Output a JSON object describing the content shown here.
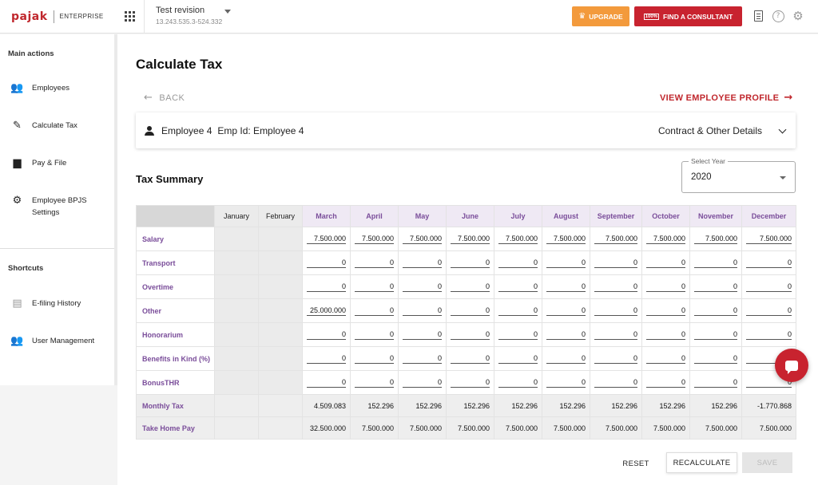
{
  "header": {
    "logo_text": "pajak",
    "edition": "ENTERPRISE",
    "revision_title": "Test revision",
    "revision_id": "13.243.535.3-524.332",
    "upgrade_label": "UPGRADE",
    "consultant_label": "FIND A CONSULTANT",
    "consultant_badge": "100%"
  },
  "sidebar": {
    "main_actions_title": "Main actions",
    "items": [
      {
        "label": "Employees",
        "icon": "people-icon"
      },
      {
        "label": "Calculate Tax",
        "icon": "pencil-icon"
      },
      {
        "label": "Pay & File",
        "icon": "document-icon"
      },
      {
        "label": "Employee BPJS Settings",
        "icon": "gear-icon"
      }
    ],
    "shortcuts_title": "Shortcuts",
    "shortcuts": [
      {
        "label": "E-filing History",
        "icon": "efiling-icon"
      },
      {
        "label": "User Management",
        "icon": "users-icon"
      }
    ]
  },
  "page": {
    "title": "Calculate Tax",
    "back_label": "BACK",
    "view_profile_label": "VIEW EMPLOYEE PROFILE"
  },
  "employee": {
    "name": "Employee 4",
    "emp_id_text": "Emp Id: Employee 4",
    "contract_label": "Contract & Other Details"
  },
  "summary": {
    "title": "Tax Summary",
    "year_label": "Select Year",
    "year_value": "2020"
  },
  "table": {
    "months": [
      "January",
      "February",
      "March",
      "April",
      "May",
      "June",
      "July",
      "August",
      "September",
      "October",
      "November",
      "December"
    ],
    "input_rows": [
      {
        "label": "Salary",
        "values": [
          "7.500.000",
          "7.500.000",
          "7.500.000",
          "7.500.000",
          "7.500.000",
          "7.500.000",
          "7.500.000",
          "7.500.000",
          "7.500.000",
          "7.500.000"
        ]
      },
      {
        "label": "Transport",
        "values": [
          "0",
          "0",
          "0",
          "0",
          "0",
          "0",
          "0",
          "0",
          "0",
          "0"
        ]
      },
      {
        "label": "Overtime",
        "values": [
          "0",
          "0",
          "0",
          "0",
          "0",
          "0",
          "0",
          "0",
          "0",
          "0"
        ]
      },
      {
        "label": "Other",
        "values": [
          "25.000.000",
          "0",
          "0",
          "0",
          "0",
          "0",
          "0",
          "0",
          "0",
          "0"
        ]
      },
      {
        "label": "Honorarium",
        "values": [
          "0",
          "0",
          "0",
          "0",
          "0",
          "0",
          "0",
          "0",
          "0",
          "0"
        ]
      },
      {
        "label": "Benefits in Kind (%)",
        "values": [
          "0",
          "0",
          "0",
          "0",
          "0",
          "0",
          "0",
          "0",
          "0",
          "0"
        ]
      },
      {
        "label": "BonusTHR",
        "values": [
          "0",
          "0",
          "0",
          "0",
          "0",
          "0",
          "0",
          "0",
          "0",
          "0"
        ]
      }
    ],
    "calc_rows": [
      {
        "label": "Monthly Tax",
        "values": [
          "4.509.083",
          "152.296",
          "152.296",
          "152.296",
          "152.296",
          "152.296",
          "152.296",
          "152.296",
          "152.296",
          "-1.770.868"
        ]
      },
      {
        "label": "Take Home Pay",
        "values": [
          "32.500.000",
          "7.500.000",
          "7.500.000",
          "7.500.000",
          "7.500.000",
          "7.500.000",
          "7.500.000",
          "7.500.000",
          "7.500.000",
          "7.500.000"
        ]
      }
    ]
  },
  "footer": {
    "reset_label": "RESET",
    "recalc_label": "RECALCULATE",
    "save_label": "SAVE"
  },
  "colors": {
    "brand_red": "#c8232f",
    "upgrade_orange": "#f39a3c",
    "label_purple": "#7a4d9a"
  }
}
